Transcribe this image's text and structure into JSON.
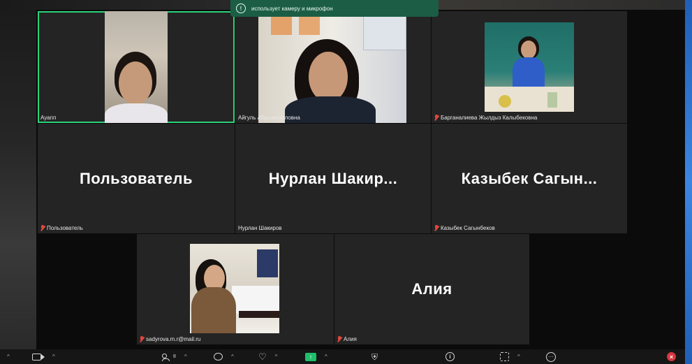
{
  "notification": {
    "text": "использует камеру и микрофон"
  },
  "participants": {
    "ayapp": {
      "label": "Ауапп"
    },
    "aitul": {
      "label": "Айгуль Абдыжалиловна"
    },
    "barganalieva": {
      "label": "Барганалиева Жылдыз Калыбековна"
    },
    "user": {
      "display": "Пользователь",
      "label": "Пользователь"
    },
    "nurlan": {
      "display": "Нурлан  Шакир...",
      "label": "Нурлан Шакиров"
    },
    "kazybek": {
      "display": "Казыбек  Сагын...",
      "label": "Казыбек Сагынбеков"
    },
    "sadyrova": {
      "label": "sadyrova.m.r@mail.ru"
    },
    "aliya": {
      "display": "Алия",
      "label": "Алия"
    }
  },
  "toolbar": {
    "participants_count": "8"
  },
  "colors": {
    "active_speaker": "#2bd27a",
    "mic_muted": "#e0483e",
    "share": "#1fbf6b",
    "end": "#d9363e"
  }
}
